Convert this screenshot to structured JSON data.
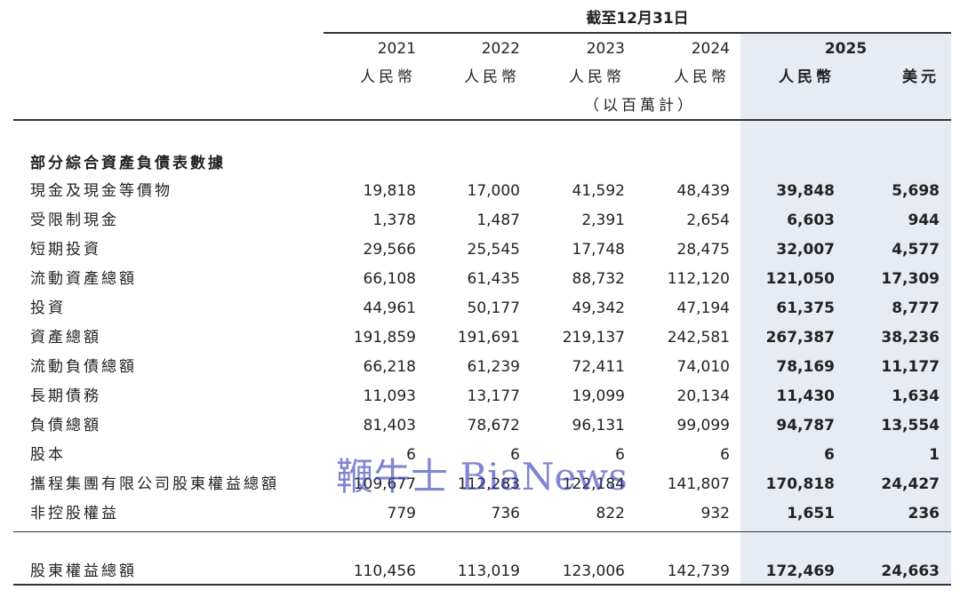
{
  "header": {
    "period": "截至12月31日",
    "years": [
      "2021",
      "2022",
      "2023",
      "2024",
      "2025"
    ],
    "currency_rmb": "人民幣",
    "currency_usd": "美元",
    "unit_note": "（以百萬計）"
  },
  "section_title": "部分綜合資產負債表數據",
  "rows": [
    {
      "label": "現金及現金等價物",
      "v2021": "19,818",
      "v2022": "17,000",
      "v2023": "41,592",
      "v2024": "48,439",
      "v2025rmb": "39,848",
      "v2025usd": "5,698"
    },
    {
      "label": "受限制現金",
      "v2021": "1,378",
      "v2022": "1,487",
      "v2023": "2,391",
      "v2024": "2,654",
      "v2025rmb": "6,603",
      "v2025usd": "944"
    },
    {
      "label": "短期投資",
      "v2021": "29,566",
      "v2022": "25,545",
      "v2023": "17,748",
      "v2024": "28,475",
      "v2025rmb": "32,007",
      "v2025usd": "4,577"
    },
    {
      "label": "流動資產總額",
      "v2021": "66,108",
      "v2022": "61,435",
      "v2023": "88,732",
      "v2024": "112,120",
      "v2025rmb": "121,050",
      "v2025usd": "17,309"
    },
    {
      "label": "投資",
      "v2021": "44,961",
      "v2022": "50,177",
      "v2023": "49,342",
      "v2024": "47,194",
      "v2025rmb": "61,375",
      "v2025usd": "8,777"
    },
    {
      "label": "資產總額",
      "v2021": "191,859",
      "v2022": "191,691",
      "v2023": "219,137",
      "v2024": "242,581",
      "v2025rmb": "267,387",
      "v2025usd": "38,236"
    },
    {
      "label": "流動負債總額",
      "v2021": "66,218",
      "v2022": "61,239",
      "v2023": "72,411",
      "v2024": "74,010",
      "v2025rmb": "78,169",
      "v2025usd": "11,177"
    },
    {
      "label": "長期債務",
      "v2021": "11,093",
      "v2022": "13,177",
      "v2023": "19,099",
      "v2024": "20,134",
      "v2025rmb": "11,430",
      "v2025usd": "1,634"
    },
    {
      "label": "負債總額",
      "v2021": "81,403",
      "v2022": "78,672",
      "v2023": "96,131",
      "v2024": "99,099",
      "v2025rmb": "94,787",
      "v2025usd": "13,554"
    },
    {
      "label": "股本",
      "v2021": "6",
      "v2022": "6",
      "v2023": "6",
      "v2024": "6",
      "v2025rmb": "6",
      "v2025usd": "1"
    },
    {
      "label": "攜程集團有限公司股東權益總額",
      "v2021": "109,677",
      "v2022": "112,283",
      "v2023": "122,184",
      "v2024": "141,807",
      "v2025rmb": "170,818",
      "v2025usd": "24,427"
    },
    {
      "label": "非控股權益",
      "v2021": "779",
      "v2022": "736",
      "v2023": "822",
      "v2024": "932",
      "v2025rmb": "1,651",
      "v2025usd": "236"
    }
  ],
  "total_row": {
    "label": "股東權益總額",
    "v2021": "110,456",
    "v2022": "113,019",
    "v2023": "123,006",
    "v2024": "142,739",
    "v2025rmb": "172,469",
    "v2025usd": "24,663"
  },
  "watermark": "鞭牛士 BiaNews"
}
